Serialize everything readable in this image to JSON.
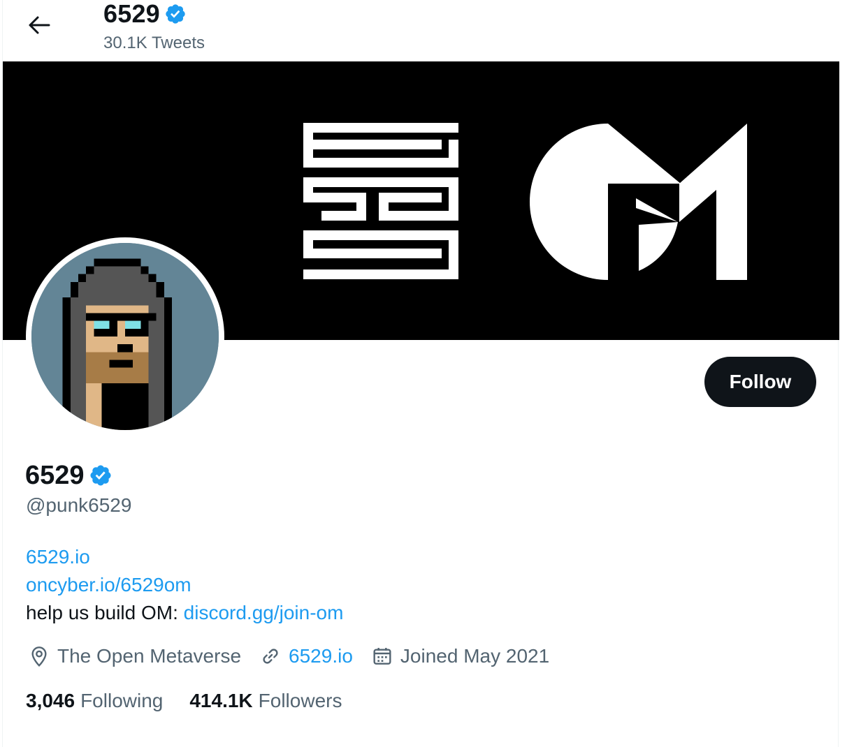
{
  "header": {
    "title": "6529",
    "tweet_count": "30.1K Tweets"
  },
  "profile": {
    "name": "6529",
    "handle": "@punk6529",
    "follow_label": "Follow",
    "bio": {
      "line1_link": "6529.io",
      "line2_link": "oncyber.io/6529om",
      "line3_text": "help us build OM: ",
      "line3_link": "discord.gg/join-om"
    },
    "meta": {
      "location": "The Open Metaverse",
      "website": "6529.io",
      "joined": "Joined May 2021"
    },
    "stats": {
      "following_count": "3,046",
      "following_label": "Following",
      "followers_count": "414.1K",
      "followers_label": "Followers"
    }
  },
  "icons": {
    "back": "arrow-left-icon",
    "verified": "verified-badge-icon",
    "location": "location-pin-icon",
    "link": "link-icon",
    "calendar": "calendar-icon"
  },
  "colors": {
    "text": "#0f1419",
    "secondary": "#536471",
    "link": "#1d9bf0",
    "button": "#0f1419",
    "banner": "#000000"
  }
}
